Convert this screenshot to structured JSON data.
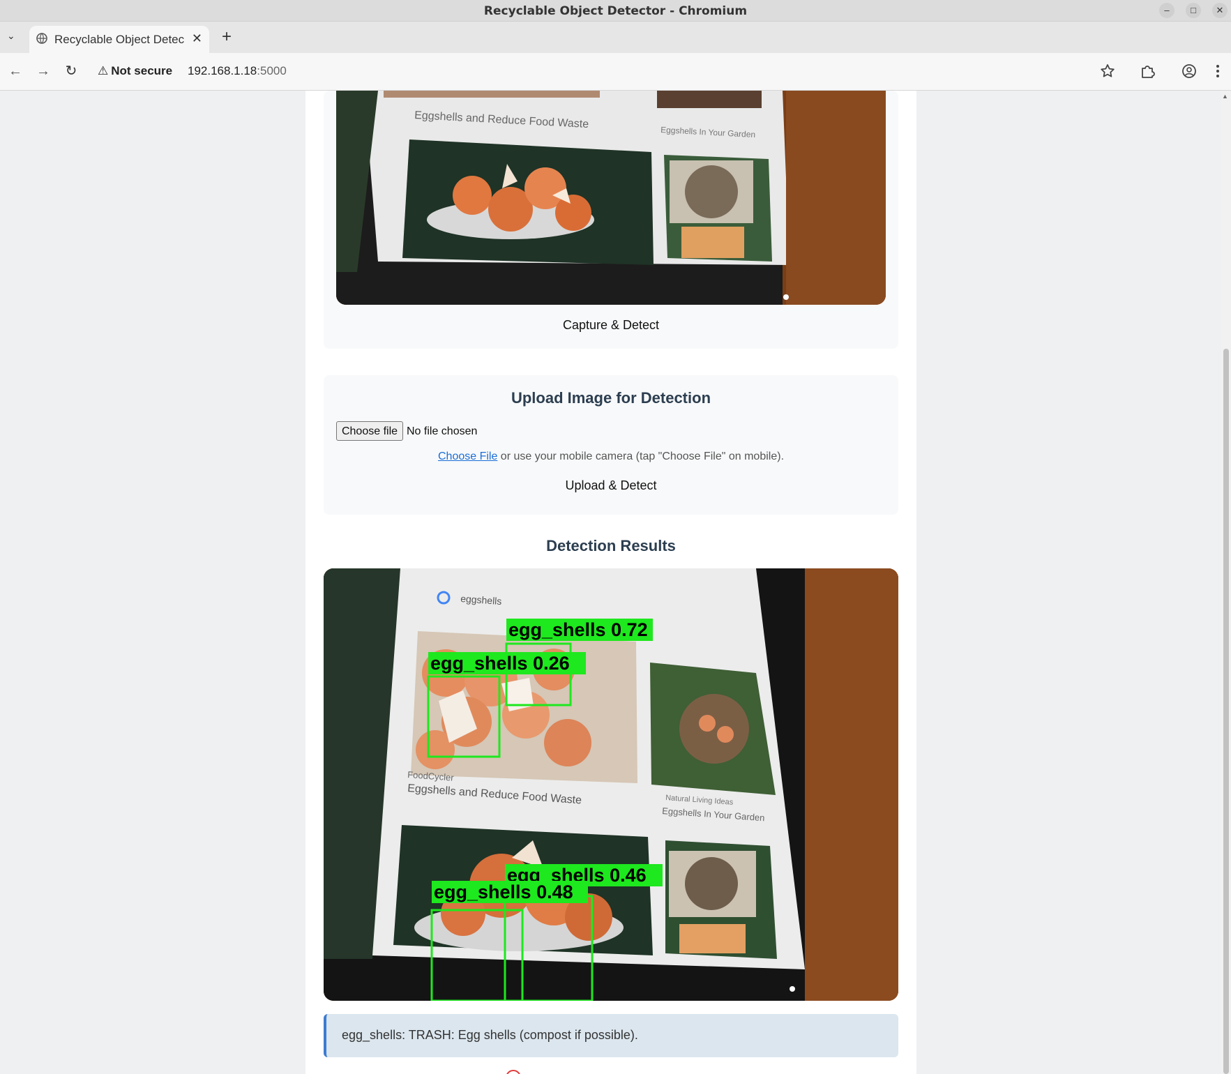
{
  "window": {
    "title": "Recyclable Object Detector - Chromium",
    "minimize": "–",
    "maximize": "□",
    "close": "✕"
  },
  "tabs": {
    "list_icon": "⌄",
    "active_title": "Recyclable Object Detec",
    "close_glyph": "✕",
    "new_tab_glyph": "+"
  },
  "toolbar": {
    "back_glyph": "←",
    "forward_glyph": "→",
    "reload_glyph": "↻",
    "security_label": "Not secure",
    "security_glyph": "⚠",
    "url_host": "192.168.1.18",
    "url_port": ":5000",
    "icons": [
      "bookmark-star-icon",
      "extensions-icon",
      "profile-icon",
      "menu-icon"
    ]
  },
  "camera": {
    "capture_button": "Capture & Detect",
    "preview_caption": "Eggshells and Reduce Food Waste",
    "preview_caption_right": "Eggshells In Your Garden"
  },
  "upload": {
    "heading": "Upload Image for Detection",
    "choose_button": "Choose file",
    "no_file": "No file chosen",
    "hint_link": "Choose File",
    "hint_text": " or use your mobile camera (tap \"Choose File\" on mobile).",
    "upload_button": "Upload & Detect"
  },
  "results": {
    "heading": "Detection Results",
    "image_search_query": "eggshells",
    "image_source_left": "FoodCycler",
    "image_caption_left": "Eggshells and Reduce Food Waste",
    "image_source_right": "Natural Living Ideas",
    "image_caption_right": "Eggshells In Your Garden",
    "detections": [
      {
        "label": "egg_shells",
        "score": "0.72"
      },
      {
        "label": "egg_shells",
        "score": "0.26"
      },
      {
        "label": "egg_shells",
        "score": "0.46"
      },
      {
        "label": "egg_shells",
        "score": "0.48"
      }
    ],
    "message": "egg_shells: TRASH: Egg shells (compost if possible)."
  },
  "colors": {
    "accent": "#3d7bd0",
    "box_green": "#1ee81e",
    "heading": "#2c3e50"
  }
}
